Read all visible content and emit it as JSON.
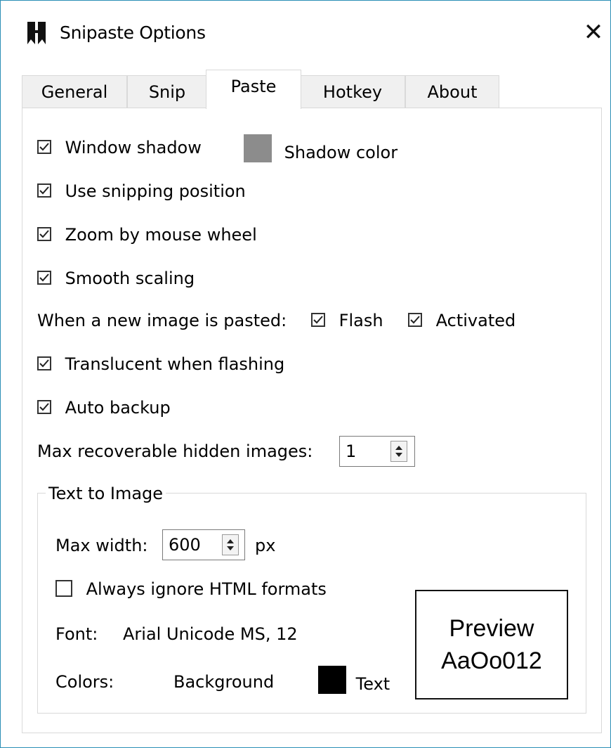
{
  "window": {
    "title": "Snipaste Options",
    "close_glyph": "✕",
    "accent": "#2b8fb6"
  },
  "tabs": [
    {
      "label": "General",
      "active": false
    },
    {
      "label": "Snip",
      "active": false
    },
    {
      "label": "Paste",
      "active": true
    },
    {
      "label": "Hotkey",
      "active": false
    },
    {
      "label": "About",
      "active": false
    }
  ],
  "paste": {
    "window_shadow": {
      "label": "Window shadow",
      "checked": true
    },
    "shadow_color": {
      "label": "Shadow color",
      "color": "#8c8c8c"
    },
    "use_snipping_position": {
      "label": "Use snipping position",
      "checked": true
    },
    "zoom_by_mouse_wheel": {
      "label": "Zoom by mouse wheel",
      "checked": true
    },
    "smooth_scaling": {
      "label": "Smooth scaling",
      "checked": true
    },
    "new_image_label": "When a new image is pasted:",
    "flash": {
      "label": "Flash",
      "checked": true
    },
    "activated": {
      "label": "Activated",
      "checked": true
    },
    "translucent_when_flashing": {
      "label": "Translucent when flashing",
      "checked": true
    },
    "auto_backup": {
      "label": "Auto backup",
      "checked": true
    },
    "max_recoverable": {
      "label": "Max recoverable hidden images:",
      "value": "1"
    }
  },
  "text_to_image": {
    "group_title": "Text to Image",
    "max_width": {
      "label": "Max width:",
      "value": "600",
      "unit": "px"
    },
    "ignore_html": {
      "label": "Always ignore HTML formats",
      "checked": false
    },
    "font": {
      "label": "Font:",
      "value": "Arial Unicode MS, 12"
    },
    "colors": {
      "label": "Colors:",
      "background_label": "Background",
      "background_color": "#ffffff",
      "text_label": "Text",
      "text_color": "#000000"
    },
    "preview": {
      "line1": "Preview",
      "line2": "AaOo012"
    }
  },
  "icons": {
    "app": "snipaste-logo-icon",
    "close": "close-icon",
    "check": "checkmark-icon",
    "spin": "spin-arrows-icon"
  }
}
